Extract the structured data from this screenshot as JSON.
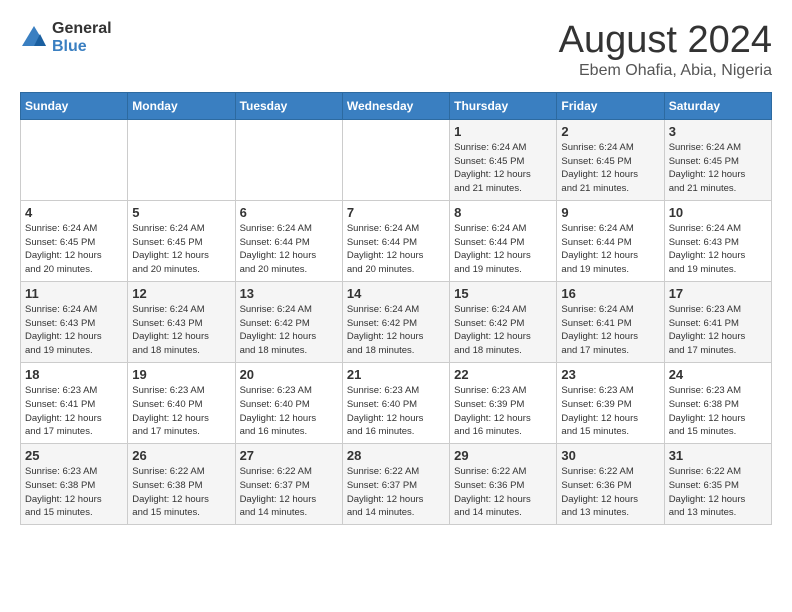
{
  "header": {
    "logo_line1": "General",
    "logo_line2": "Blue",
    "month": "August 2024",
    "location": "Ebem Ohafia, Abia, Nigeria"
  },
  "weekdays": [
    "Sunday",
    "Monday",
    "Tuesday",
    "Wednesday",
    "Thursday",
    "Friday",
    "Saturday"
  ],
  "weeks": [
    [
      {
        "day": "",
        "info": ""
      },
      {
        "day": "",
        "info": ""
      },
      {
        "day": "",
        "info": ""
      },
      {
        "day": "",
        "info": ""
      },
      {
        "day": "1",
        "info": "Sunrise: 6:24 AM\nSunset: 6:45 PM\nDaylight: 12 hours\nand 21 minutes."
      },
      {
        "day": "2",
        "info": "Sunrise: 6:24 AM\nSunset: 6:45 PM\nDaylight: 12 hours\nand 21 minutes."
      },
      {
        "day": "3",
        "info": "Sunrise: 6:24 AM\nSunset: 6:45 PM\nDaylight: 12 hours\nand 21 minutes."
      }
    ],
    [
      {
        "day": "4",
        "info": "Sunrise: 6:24 AM\nSunset: 6:45 PM\nDaylight: 12 hours\nand 20 minutes."
      },
      {
        "day": "5",
        "info": "Sunrise: 6:24 AM\nSunset: 6:45 PM\nDaylight: 12 hours\nand 20 minutes."
      },
      {
        "day": "6",
        "info": "Sunrise: 6:24 AM\nSunset: 6:44 PM\nDaylight: 12 hours\nand 20 minutes."
      },
      {
        "day": "7",
        "info": "Sunrise: 6:24 AM\nSunset: 6:44 PM\nDaylight: 12 hours\nand 20 minutes."
      },
      {
        "day": "8",
        "info": "Sunrise: 6:24 AM\nSunset: 6:44 PM\nDaylight: 12 hours\nand 19 minutes."
      },
      {
        "day": "9",
        "info": "Sunrise: 6:24 AM\nSunset: 6:44 PM\nDaylight: 12 hours\nand 19 minutes."
      },
      {
        "day": "10",
        "info": "Sunrise: 6:24 AM\nSunset: 6:43 PM\nDaylight: 12 hours\nand 19 minutes."
      }
    ],
    [
      {
        "day": "11",
        "info": "Sunrise: 6:24 AM\nSunset: 6:43 PM\nDaylight: 12 hours\nand 19 minutes."
      },
      {
        "day": "12",
        "info": "Sunrise: 6:24 AM\nSunset: 6:43 PM\nDaylight: 12 hours\nand 18 minutes."
      },
      {
        "day": "13",
        "info": "Sunrise: 6:24 AM\nSunset: 6:42 PM\nDaylight: 12 hours\nand 18 minutes."
      },
      {
        "day": "14",
        "info": "Sunrise: 6:24 AM\nSunset: 6:42 PM\nDaylight: 12 hours\nand 18 minutes."
      },
      {
        "day": "15",
        "info": "Sunrise: 6:24 AM\nSunset: 6:42 PM\nDaylight: 12 hours\nand 18 minutes."
      },
      {
        "day": "16",
        "info": "Sunrise: 6:24 AM\nSunset: 6:41 PM\nDaylight: 12 hours\nand 17 minutes."
      },
      {
        "day": "17",
        "info": "Sunrise: 6:23 AM\nSunset: 6:41 PM\nDaylight: 12 hours\nand 17 minutes."
      }
    ],
    [
      {
        "day": "18",
        "info": "Sunrise: 6:23 AM\nSunset: 6:41 PM\nDaylight: 12 hours\nand 17 minutes."
      },
      {
        "day": "19",
        "info": "Sunrise: 6:23 AM\nSunset: 6:40 PM\nDaylight: 12 hours\nand 17 minutes."
      },
      {
        "day": "20",
        "info": "Sunrise: 6:23 AM\nSunset: 6:40 PM\nDaylight: 12 hours\nand 16 minutes."
      },
      {
        "day": "21",
        "info": "Sunrise: 6:23 AM\nSunset: 6:40 PM\nDaylight: 12 hours\nand 16 minutes."
      },
      {
        "day": "22",
        "info": "Sunrise: 6:23 AM\nSunset: 6:39 PM\nDaylight: 12 hours\nand 16 minutes."
      },
      {
        "day": "23",
        "info": "Sunrise: 6:23 AM\nSunset: 6:39 PM\nDaylight: 12 hours\nand 15 minutes."
      },
      {
        "day": "24",
        "info": "Sunrise: 6:23 AM\nSunset: 6:38 PM\nDaylight: 12 hours\nand 15 minutes."
      }
    ],
    [
      {
        "day": "25",
        "info": "Sunrise: 6:23 AM\nSunset: 6:38 PM\nDaylight: 12 hours\nand 15 minutes."
      },
      {
        "day": "26",
        "info": "Sunrise: 6:22 AM\nSunset: 6:38 PM\nDaylight: 12 hours\nand 15 minutes."
      },
      {
        "day": "27",
        "info": "Sunrise: 6:22 AM\nSunset: 6:37 PM\nDaylight: 12 hours\nand 14 minutes."
      },
      {
        "day": "28",
        "info": "Sunrise: 6:22 AM\nSunset: 6:37 PM\nDaylight: 12 hours\nand 14 minutes."
      },
      {
        "day": "29",
        "info": "Sunrise: 6:22 AM\nSunset: 6:36 PM\nDaylight: 12 hours\nand 14 minutes."
      },
      {
        "day": "30",
        "info": "Sunrise: 6:22 AM\nSunset: 6:36 PM\nDaylight: 12 hours\nand 13 minutes."
      },
      {
        "day": "31",
        "info": "Sunrise: 6:22 AM\nSunset: 6:35 PM\nDaylight: 12 hours\nand 13 minutes."
      }
    ]
  ]
}
